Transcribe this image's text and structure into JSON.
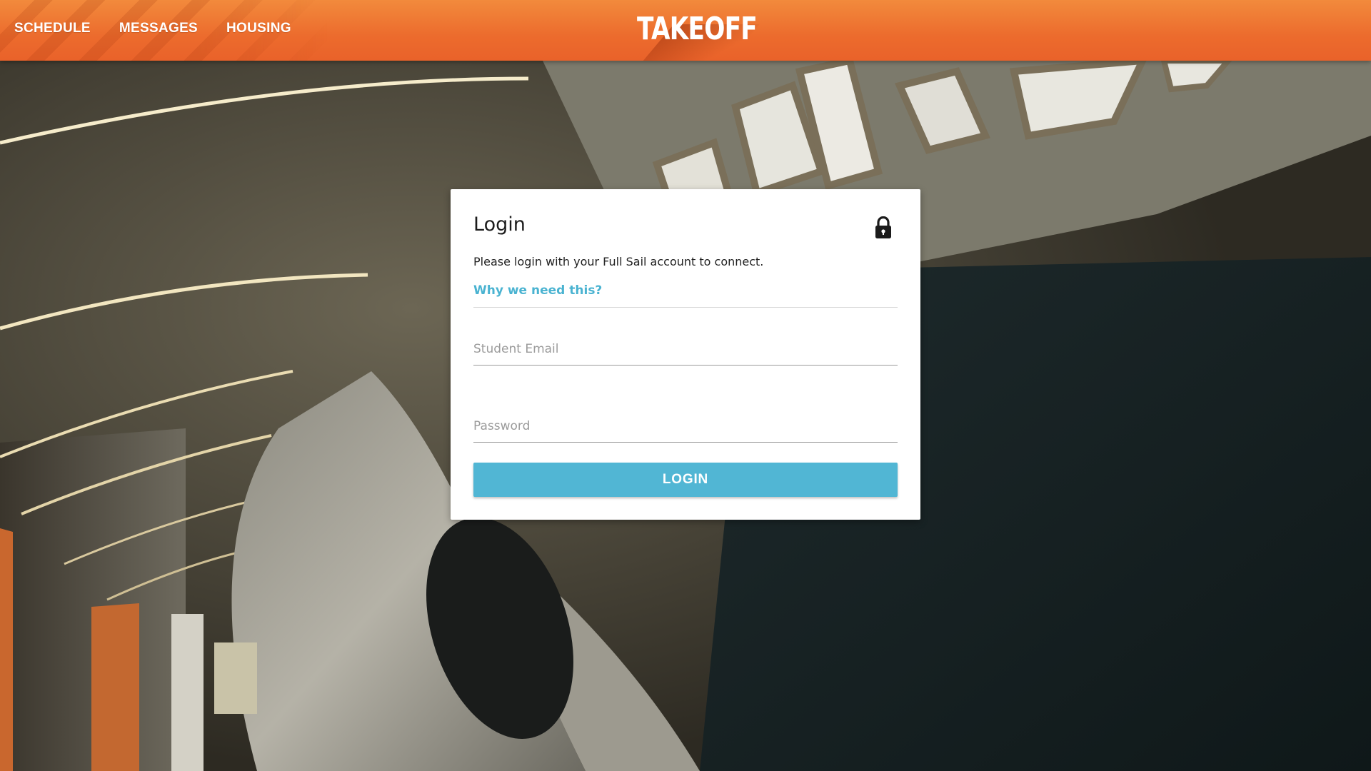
{
  "nav": {
    "items": [
      {
        "label": "SCHEDULE"
      },
      {
        "label": "MESSAGES"
      },
      {
        "label": "HOUSING"
      }
    ],
    "logo_text": "TAKEOFF"
  },
  "login": {
    "title": "Login",
    "description": "Please login with your Full Sail account to connect.",
    "why_link": "Why we need this?",
    "email_placeholder": "Student Email",
    "password_placeholder": "Password",
    "button_label": "LOGIN",
    "lock_icon": "lock-icon"
  },
  "colors": {
    "header_orange": "#ec6b2d",
    "accent_blue": "#51b6d4",
    "link_blue": "#4ab3d1"
  }
}
